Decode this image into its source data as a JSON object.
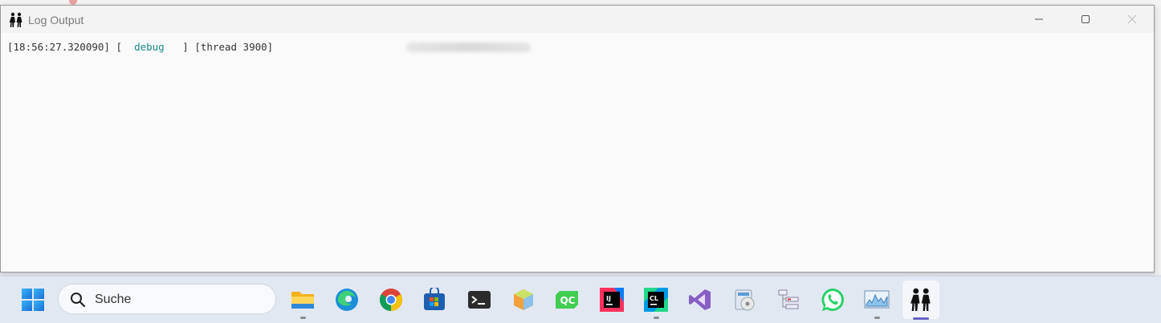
{
  "window": {
    "title": "Log Output"
  },
  "log": {
    "lines": [
      {
        "timestamp": "[18:56:27.320090]",
        "level_open": "[",
        "level": "debug",
        "level_close": "]",
        "thread": "[thread 3900]"
      }
    ]
  },
  "taskbar": {
    "search_placeholder": "Suche",
    "apps": [
      {
        "name": "file-explorer-icon"
      },
      {
        "name": "edge-icon"
      },
      {
        "name": "chrome-icon"
      },
      {
        "name": "store-icon"
      },
      {
        "name": "terminal-icon"
      },
      {
        "name": "package-icon"
      },
      {
        "name": "qc-icon"
      },
      {
        "name": "intellij-icon"
      },
      {
        "name": "clion-icon"
      },
      {
        "name": "visual-studio-icon"
      },
      {
        "name": "installer-icon"
      },
      {
        "name": "network-tool-icon"
      },
      {
        "name": "whatsapp-icon"
      },
      {
        "name": "monitor-icon"
      },
      {
        "name": "log-app-icon"
      }
    ]
  },
  "colors": {
    "debug_level": "#1a8a8a",
    "active_indicator": "#6b63c6"
  }
}
